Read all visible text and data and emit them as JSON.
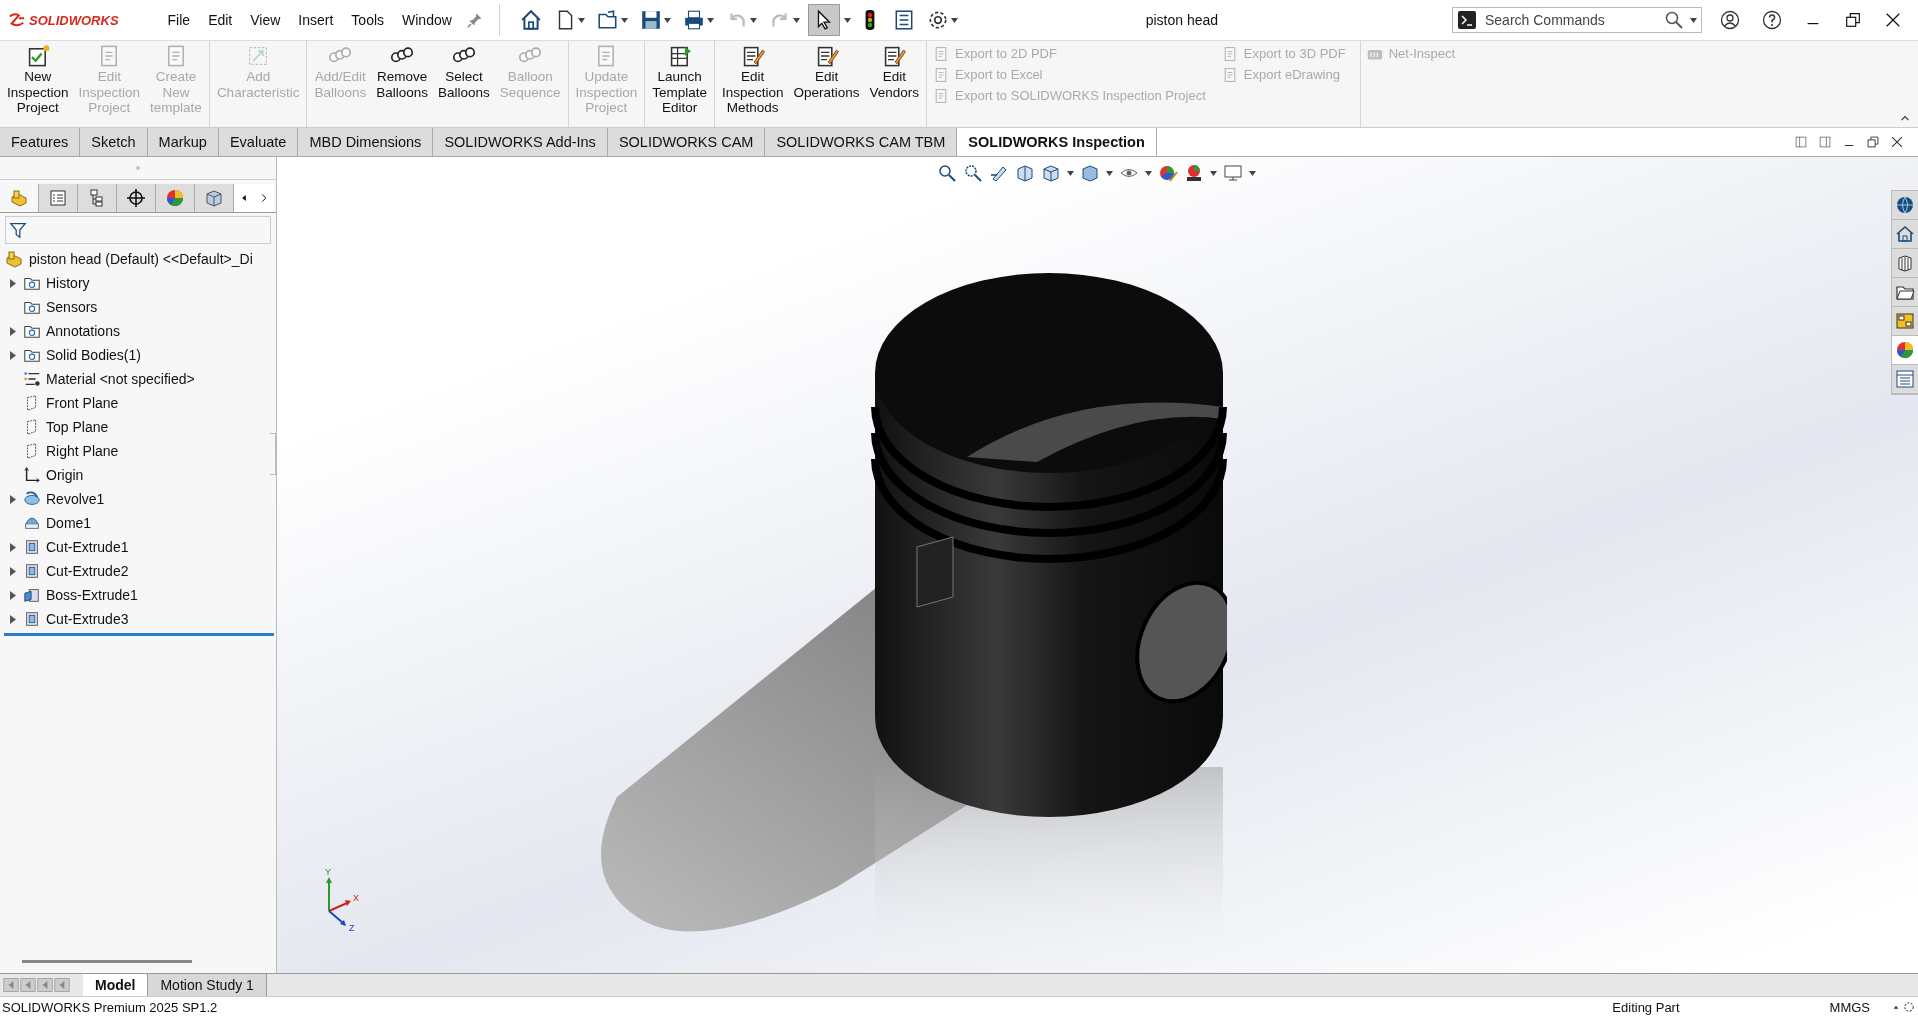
{
  "app": {
    "logo": "SOLIDWORKS",
    "menu": [
      "File",
      "Edit",
      "View",
      "Insert",
      "Tools",
      "Window"
    ],
    "title": "piston head"
  },
  "search": {
    "placeholder": "Search Commands"
  },
  "ribbon": {
    "groups": [
      {
        "buttons": [
          {
            "label": "New\nInspection\nProject",
            "disabled": false
          },
          {
            "label": "Edit\nInspection\nProject",
            "disabled": true
          },
          {
            "label": "Create\nNew\ntemplate",
            "disabled": true
          }
        ]
      },
      {
        "buttons": [
          {
            "label": "Add\nCharacteristic",
            "disabled": true
          }
        ]
      },
      {
        "buttons": [
          {
            "label": "Add/Edit\nBalloons",
            "disabled": true
          },
          {
            "label": "Remove\nBalloons",
            "disabled": false
          },
          {
            "label": "Select\nBalloons",
            "disabled": false
          },
          {
            "label": "Balloon\nSequence",
            "disabled": true
          }
        ]
      },
      {
        "buttons": [
          {
            "label": "Update\nInspection\nProject",
            "disabled": true
          }
        ]
      },
      {
        "buttons": [
          {
            "label": "Launch\nTemplate\nEditor",
            "disabled": false
          }
        ]
      },
      {
        "buttons": [
          {
            "label": "Edit\nInspection\nMethods",
            "disabled": false
          },
          {
            "label": "Edit\nOperations",
            "disabled": false
          },
          {
            "label": "Edit\nVendors",
            "disabled": false
          }
        ]
      }
    ],
    "exports": [
      [
        {
          "label": "Export to 2D PDF",
          "disabled": true
        },
        {
          "label": "Export to Excel",
          "disabled": true
        },
        {
          "label": "Export to SOLIDWORKS Inspection Project",
          "disabled": true
        }
      ],
      [
        {
          "label": "Export to 3D PDF",
          "disabled": true
        },
        {
          "label": "Export eDrawing",
          "disabled": true
        }
      ]
    ],
    "net_inspect": {
      "label": "Net-Inspect",
      "disabled": true
    }
  },
  "tabs": [
    {
      "label": "Features",
      "selected": false
    },
    {
      "label": "Sketch",
      "selected": false
    },
    {
      "label": "Markup",
      "selected": false
    },
    {
      "label": "Evaluate",
      "selected": false
    },
    {
      "label": "MBD Dimensions",
      "selected": false
    },
    {
      "label": "SOLIDWORKS Add-Ins",
      "selected": false
    },
    {
      "label": "SOLIDWORKS CAM",
      "selected": false
    },
    {
      "label": "SOLIDWORKS CAM TBM",
      "selected": false
    },
    {
      "label": "SOLIDWORKS Inspection",
      "selected": true
    }
  ],
  "feature_manager": {
    "panel_tabs": [
      {
        "selected": true
      },
      {
        "selected": false
      },
      {
        "selected": false
      },
      {
        "selected": false
      },
      {
        "selected": false
      },
      {
        "selected": false
      }
    ],
    "tree": {
      "root": "piston head (Default) <<Default>_Di",
      "items": [
        {
          "label": "History",
          "kind": "folder",
          "expandable": true
        },
        {
          "label": "Sensors",
          "kind": "folder",
          "expandable": false
        },
        {
          "label": "Annotations",
          "kind": "folder",
          "expandable": true
        },
        {
          "label": "Solid Bodies(1)",
          "kind": "folder",
          "expandable": true
        },
        {
          "label": "Material <not specified>",
          "kind": "material",
          "expandable": false
        },
        {
          "label": "Front Plane",
          "kind": "plane",
          "expandable": false
        },
        {
          "label": "Top Plane",
          "kind": "plane",
          "expandable": false
        },
        {
          "label": "Right Plane",
          "kind": "plane",
          "expandable": false
        },
        {
          "label": "Origin",
          "kind": "origin",
          "expandable": false
        },
        {
          "label": "Revolve1",
          "kind": "revolve",
          "expandable": true
        },
        {
          "label": "Dome1",
          "kind": "dome",
          "expandable": false
        },
        {
          "label": "Cut-Extrude1",
          "kind": "extrude",
          "expandable": true
        },
        {
          "label": "Cut-Extrude2",
          "kind": "extrude",
          "expandable": true
        },
        {
          "label": "Boss-Extrude1",
          "kind": "boss",
          "expandable": true
        },
        {
          "label": "Cut-Extrude3",
          "kind": "extrude",
          "expandable": true
        }
      ]
    }
  },
  "viewport": {
    "triad": {
      "x": "X",
      "y": "Y",
      "z": "Z"
    },
    "task_pane": [
      {
        "selected": false
      },
      {
        "selected": false
      },
      {
        "selected": false
      },
      {
        "selected": false
      },
      {
        "selected": false
      },
      {
        "selected": true
      },
      {
        "selected": false
      }
    ]
  },
  "bottom_tabs": [
    {
      "label": "Model",
      "selected": true
    },
    {
      "label": "Motion Study 1",
      "selected": false
    }
  ],
  "status_bar": {
    "product": "SOLIDWORKS Premium 2025 SP1.2",
    "mode": "Editing Part",
    "units": "MMGS"
  }
}
